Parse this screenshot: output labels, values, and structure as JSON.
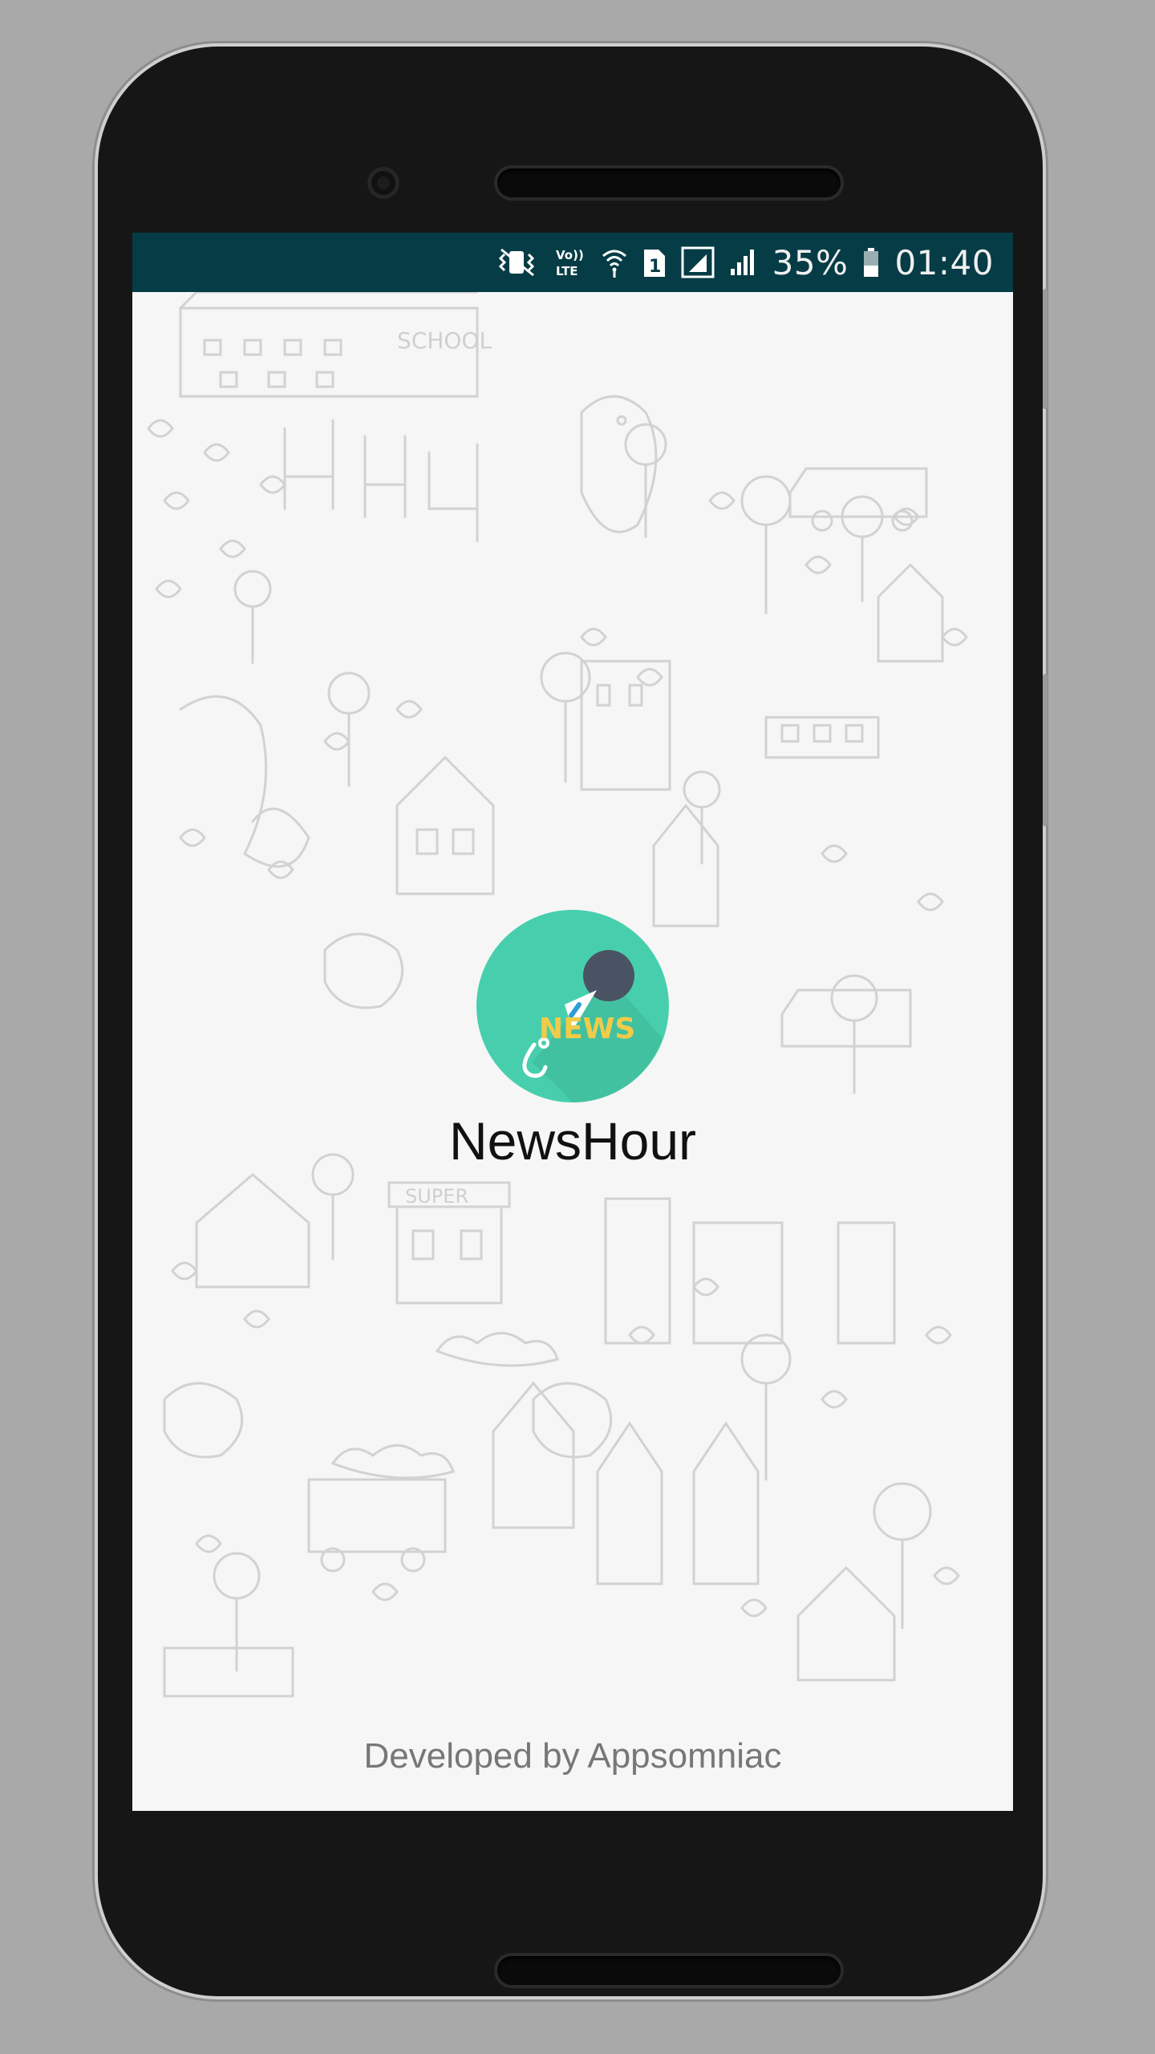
{
  "status_bar": {
    "battery_percent": "35%",
    "time": "01:40",
    "volte_label": "Vo)) LTE",
    "sim_number": "1",
    "icons": [
      "vibrate-icon",
      "volte-icon",
      "wifi-icon",
      "sim-1-icon",
      "signal-icon",
      "signal-icon",
      "battery-icon"
    ],
    "background_color": "#063c45"
  },
  "splash": {
    "app_name": "NewsHour",
    "logo_text": "NEWS",
    "developer_credit": "Developed by Appsomniac",
    "logo_circle_color": "#47cfad",
    "logo_text_color": "#f2cb48",
    "doodle_labels": [
      "SCHOOL",
      "SUPER"
    ]
  }
}
